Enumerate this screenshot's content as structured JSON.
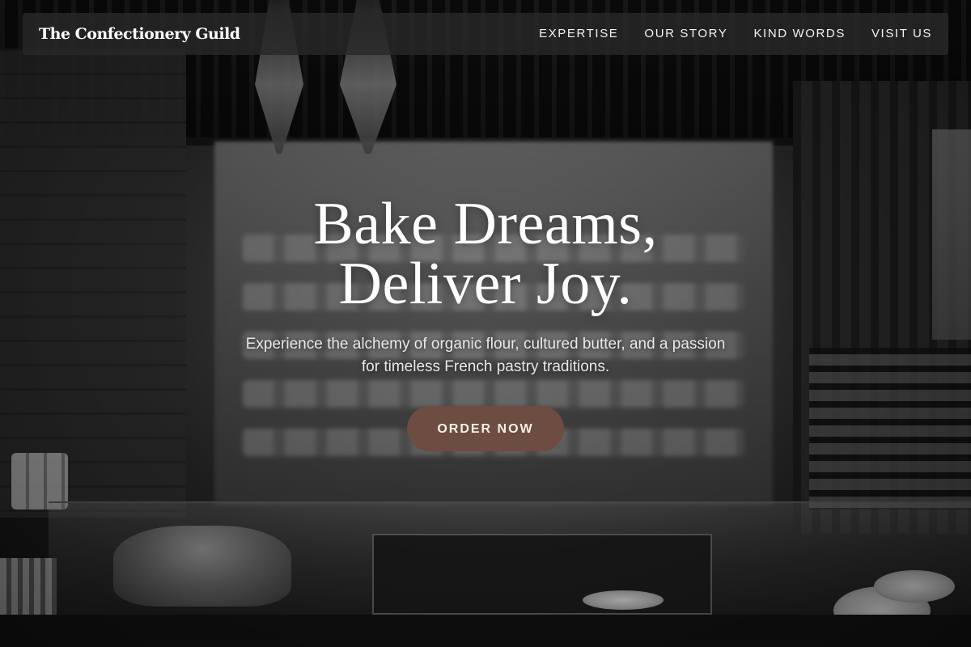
{
  "brand": {
    "name": "The Confectionery Guild"
  },
  "nav": {
    "items": [
      {
        "label": "EXPERTISE"
      },
      {
        "label": "OUR STORY"
      },
      {
        "label": "KIND WORDS"
      },
      {
        "label": "VISIT US"
      }
    ]
  },
  "hero": {
    "headline_line1": "Bake Dreams,",
    "headline_line2": "Deliver Joy.",
    "subtitle": "Experience the alchemy of organic flour, cultured butter, and a passion for timeless French pastry traditions.",
    "cta_label": "ORDER NOW",
    "background_image": "bakery-interior-photo"
  },
  "colors": {
    "navbar_bg": "#282828",
    "cta_bg": "#6d4c41",
    "text_primary": "#ffffff"
  }
}
